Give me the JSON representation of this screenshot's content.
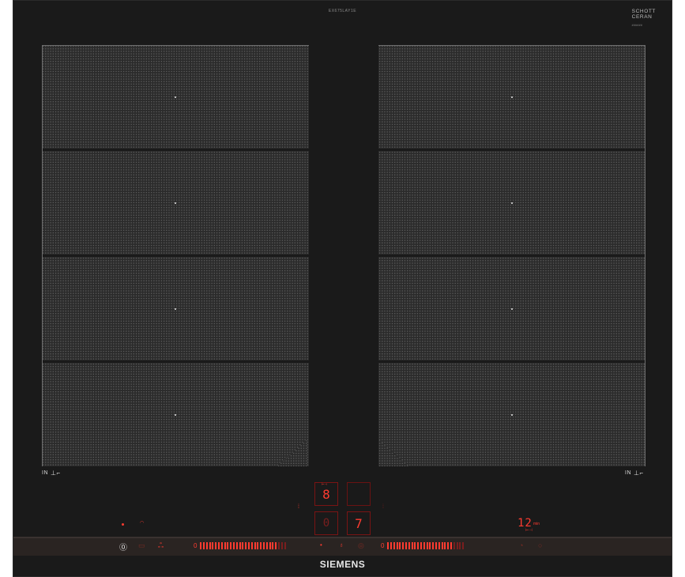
{
  "panel": {
    "model_code": "EX675LAY1E",
    "glass_brand_lines": [
      "SCHOTT",
      "CERAN"
    ],
    "glass_brand_sub": "######",
    "brand": "SIEMENS"
  },
  "zones": {
    "left_label": "IN",
    "right_label": "IN"
  },
  "display": {
    "top_digit": "8",
    "bottom_digit": "0",
    "right_digit": "7",
    "timer_value": "12",
    "timer_unit": "min"
  },
  "sliders": {
    "left_zero": "0",
    "right_zero": "0"
  },
  "colors": {
    "glass": "#1a1a1a",
    "zone": "#2b2b2b",
    "indicator_red": "#ff3b30",
    "control_strip": "#2a2422"
  }
}
